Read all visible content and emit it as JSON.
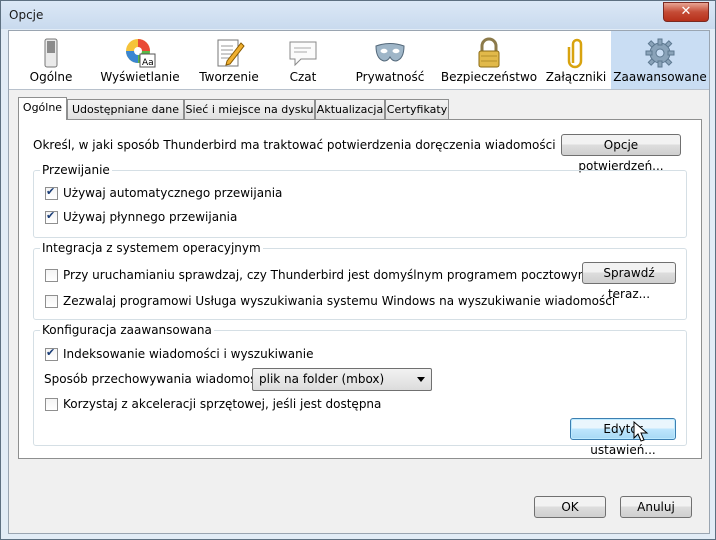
{
  "window": {
    "title": "Opcje",
    "close_glyph": "✕"
  },
  "panes": [
    {
      "label": "Ogólne",
      "icon": "switch-icon"
    },
    {
      "label": "Wyświetlanie",
      "icon": "color-wheel-icon"
    },
    {
      "label": "Tworzenie",
      "icon": "pencil-paper-icon"
    },
    {
      "label": "Czat",
      "icon": "chat-bubble-icon"
    },
    {
      "label": "Prywatność",
      "icon": "mask-icon"
    },
    {
      "label": "Bezpieczeństwo",
      "icon": "padlock-icon"
    },
    {
      "label": "Załączniki",
      "icon": "paperclip-icon"
    },
    {
      "label": "Zaawansowane",
      "icon": "gear-icon",
      "selected": true
    }
  ],
  "tabs": [
    {
      "label": "Ogólne",
      "active": true
    },
    {
      "label": "Udostępniane dane"
    },
    {
      "label": "Sieć i miejsce na dysku"
    },
    {
      "label": "Aktualizacja"
    },
    {
      "label": "Certyfikaty"
    }
  ],
  "receipts": {
    "description": "Określ, w jaki sposób Thunderbird ma traktować potwierdzenia doręczenia wiadomości",
    "button": "Opcje potwierdzeń..."
  },
  "scrolling": {
    "legend": "Przewijanie",
    "autoscroll_label": "Używaj automatycznego przewijania",
    "autoscroll_checked": true,
    "smooth_label": "Używaj płynnego przewijania",
    "smooth_checked": true
  },
  "system": {
    "legend": "Integracja z systemem operacyjnym",
    "default_check_label": "Przy uruchamianiu sprawdzaj, czy Thunderbird jest domyślnym programem pocztowym",
    "default_check_checked": false,
    "check_now_button": "Sprawdź teraz...",
    "search_label": "Zezwalaj programowi Usługa wyszukiwania systemu Windows na wyszukiwanie wiadomości",
    "search_checked": false
  },
  "advanced": {
    "legend": "Konfiguracja zaawansowana",
    "indexing_label": "Indeksowanie wiadomości i wyszukiwanie",
    "indexing_checked": true,
    "storage_label": "Sposób przechowywania wiadomości:",
    "storage_value": "plik na folder (mbox)",
    "hw_accel_label": "Korzystaj z akceleracji sprzętowej, jeśli jest dostępna",
    "hw_accel_checked": false,
    "config_editor_button": "Edytor ustawień..."
  },
  "footer": {
    "ok": "OK",
    "cancel": "Anuluj"
  }
}
